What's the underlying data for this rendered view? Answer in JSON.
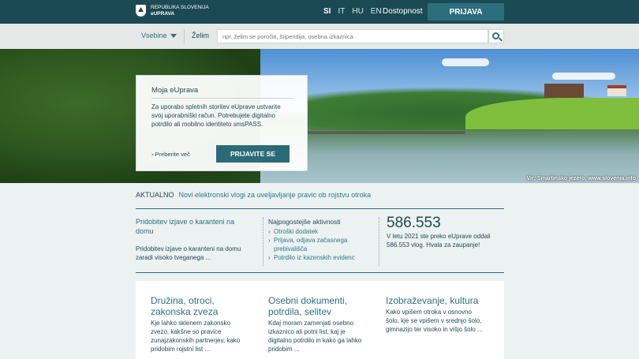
{
  "header": {
    "logo_line1": "REPUBLIKA SLOVENIJA",
    "logo_line2": "eUPRAVA",
    "languages": [
      "SI",
      "IT",
      "HU",
      "EN"
    ],
    "accessibility": "Dostopnost",
    "login_button": "PRIJAVA"
  },
  "searchbar": {
    "menu_label": "Vsebine",
    "want_label": "Želim",
    "placeholder": "npr. želim se poročiti, štipendija, osebna izkaznica"
  },
  "hero": {
    "caption": "Vir: Šmartinsko jezero, www.slovenia.info"
  },
  "card": {
    "title": "Moja eUprava",
    "text": "Za uporabo spletnih storitev eUprave ustvarite svoj uporabniški račun. Potrebujete digitalno potrdilo ali mobilno identiteto smsPASS.",
    "more_link": "› Preberite več",
    "button": "PRIJAVITE SE"
  },
  "news": {
    "label": "AKTUALNO",
    "link": "Novi elektronski vlogi za uveljavljanje pravic ob rojstvu otroka"
  },
  "featured": {
    "title": "Pridobitev izjave o karanteni na domu",
    "text": "Pridobitev izjave o karanteni na domu zaradi visoko tveganega ..."
  },
  "activities": {
    "title": "Najpogostejše aktivnosti",
    "items": [
      "Otroški dodatek",
      "Prijava, odjava začasnega prebivališča",
      "Potrdilo iz kazenskih evidenc"
    ]
  },
  "stats": {
    "number": "586.553",
    "text": "V letu 2021 ste preko eUprave oddali 586.553 vlog. Hvala za zaupanje!"
  },
  "categories": [
    {
      "title": "Družina, otroci, zakonska zveza",
      "text": "Kje lahko sklenem zakonsko zvezo, kakšne so pravice zunajzakonskih partnerjev, kako pridobim rojstni list ..."
    },
    {
      "title": "Osebni dokumenti, potrdila, selitev",
      "text": "Kdaj moram zamenjati osebno izkaznico ali potni list, kaj je digitalno potrdilo in kako ga lahko pridobim ..."
    },
    {
      "title": "Izobraževanje, kultura",
      "text": "Kako vpišem otroka v osnovno šolo, kje se vpišem v srednjo šolo, gimnazijo ter visoko in višjo šolo ..."
    }
  ],
  "colors": {
    "header_bg": "#1b4a54",
    "accent": "#2c6f7c",
    "link": "#2c7a88"
  }
}
